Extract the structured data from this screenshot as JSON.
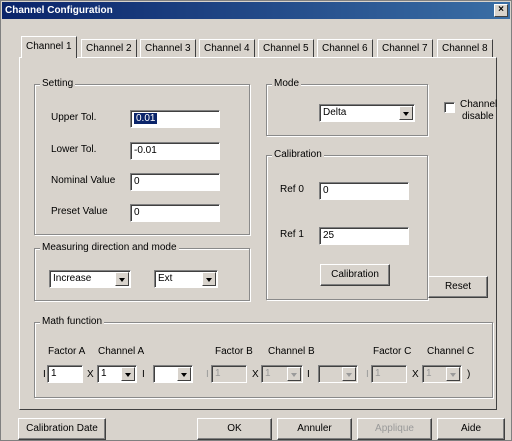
{
  "window": {
    "title": "Channel Configuration",
    "close": "×"
  },
  "tabs": [
    "Channel 1",
    "Channel 2",
    "Channel 3",
    "Channel 4",
    "Channel 5",
    "Channel 6",
    "Channel 7",
    "Channel 8"
  ],
  "setting": {
    "title": "Setting",
    "upper_tol_label": "Upper Tol.",
    "upper_tol_value": "0.01",
    "lower_tol_label": "Lower Tol.",
    "lower_tol_value": "-0.01",
    "nominal_label": "Nominal Value",
    "nominal_value": "0",
    "preset_label": "Preset Value",
    "preset_value": "0"
  },
  "mode": {
    "title": "Mode",
    "value": "Delta"
  },
  "channel_disable": {
    "line1": "Channel",
    "line2": "disable",
    "checked": false
  },
  "calibration": {
    "title": "Calibration",
    "ref0_label": "Ref 0",
    "ref0_value": "0",
    "ref1_label": "Ref 1",
    "ref1_value": "25",
    "button": "Calibration"
  },
  "measuring": {
    "title": "Measuring direction and mode",
    "direction": "Increase",
    "mode": "Ext"
  },
  "reset_button": "Reset",
  "math": {
    "title": "Math function",
    "factor_a_label": "Factor A",
    "channel_a_label": "Channel A",
    "factor_b_label": "Factor B",
    "channel_b_label": "Channel B",
    "factor_c_label": "Factor C",
    "channel_c_label": "Channel C",
    "factor_a": "1",
    "channel_a": "1",
    "factor_b": "1",
    "channel_b": "1",
    "factor_c": "1",
    "channel_c": "1",
    "sep": "I",
    "times": "X",
    "close_paren": ")"
  },
  "footer": {
    "calibration_date": "Calibration Date",
    "ok": "OK",
    "cancel": "Annuler",
    "apply": "Applique",
    "help": "Aide"
  }
}
